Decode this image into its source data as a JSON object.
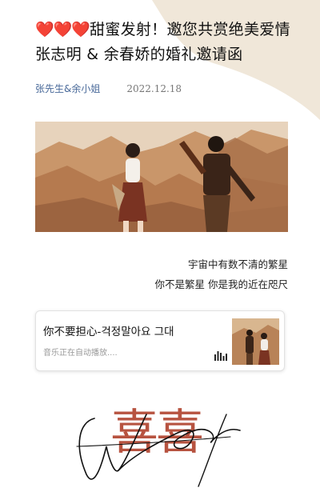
{
  "article": {
    "title_line1_hearts": "❤️❤️❤️",
    "title_line1_text": "甜蜜发射！邀您共赏绝美爱情",
    "title_line2": "张志明 & 余春娇的婚礼邀请函",
    "author": "张先生&余小姐",
    "date": "2022.12.18"
  },
  "poem": {
    "line1": "宇宙中有数不清的繁星",
    "line2": "你不是繁星  你是我的近在咫尺"
  },
  "music": {
    "title": "你不要担心-걱정말아요 그대",
    "status": "音乐正在自动播放....",
    "icon": "equalizer-icon"
  },
  "logo": {
    "characters": "喜喜",
    "script_text": "Wedding"
  },
  "colors": {
    "heart": "#e0201b",
    "author_link": "#4a6a9a",
    "logo_red": "#b44a36",
    "bg_wave": "#efe5d6"
  }
}
